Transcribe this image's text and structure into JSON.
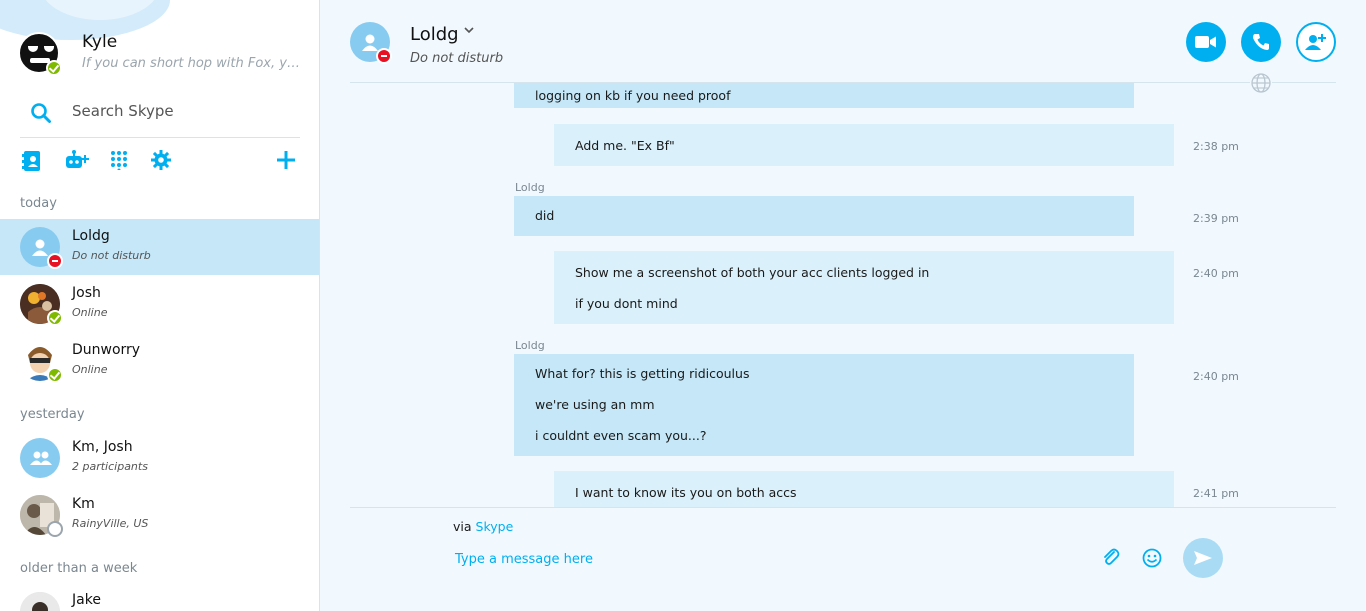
{
  "profile": {
    "name": "Kyle",
    "mood": "If you can short hop with Fox, you ..."
  },
  "search": {
    "placeholder": "Search Skype"
  },
  "toolbar": {
    "icons": [
      "contacts-icon",
      "add-bot-icon",
      "dialpad-icon",
      "settings-icon",
      "new-conversation-icon"
    ]
  },
  "sections": {
    "today": "today",
    "yesterday": "yesterday",
    "older": "older than a week"
  },
  "contacts": [
    {
      "name": "Loldg",
      "status": "Do not disturb"
    },
    {
      "name": "Josh",
      "status": "Online"
    },
    {
      "name": "Dunworry",
      "status": "Online"
    },
    {
      "name": "Km, Josh",
      "status": "2 participants"
    },
    {
      "name": "Km",
      "status": "RainyVille, US"
    },
    {
      "name": "Jake",
      "status": ""
    }
  ],
  "conversation": {
    "name": "Loldg",
    "status": "Do not disturb",
    "messages": [
      {
        "from": "Loldg",
        "direction": "in",
        "lines": [
          "logging on kb if you need proof"
        ],
        "time": ""
      },
      {
        "from": "Kyle",
        "direction": "out",
        "lines": [
          "Add me. \"Ex Bf\""
        ],
        "time": "2:38 pm"
      },
      {
        "from": "Loldg",
        "direction": "in",
        "sender_label": "Loldg",
        "lines": [
          "did"
        ],
        "time": "2:39 pm"
      },
      {
        "from": "Kyle",
        "direction": "out",
        "lines": [
          "Show me a screenshot of both your acc clients logged in",
          "if you dont mind"
        ],
        "time": "2:40 pm"
      },
      {
        "from": "Loldg",
        "direction": "in",
        "sender_label": "Loldg",
        "lines": [
          "What for? this is getting ridicoulus",
          "we're using an mm",
          "i couldnt even scam you...?"
        ],
        "time": "2:40 pm"
      },
      {
        "from": "Kyle",
        "direction": "out",
        "lines": [
          "I want to know its you on both accs"
        ],
        "time": "2:41 pm"
      }
    ]
  },
  "composer": {
    "via_prefix": "via",
    "via_service": "Skype",
    "placeholder": "Type a message here"
  },
  "colors": {
    "accent": "#00aff0",
    "incoming_bubble": "#c5e7f8",
    "outgoing_bubble": "#daf0fb",
    "online": "#7fba00",
    "dnd": "#e81123"
  }
}
